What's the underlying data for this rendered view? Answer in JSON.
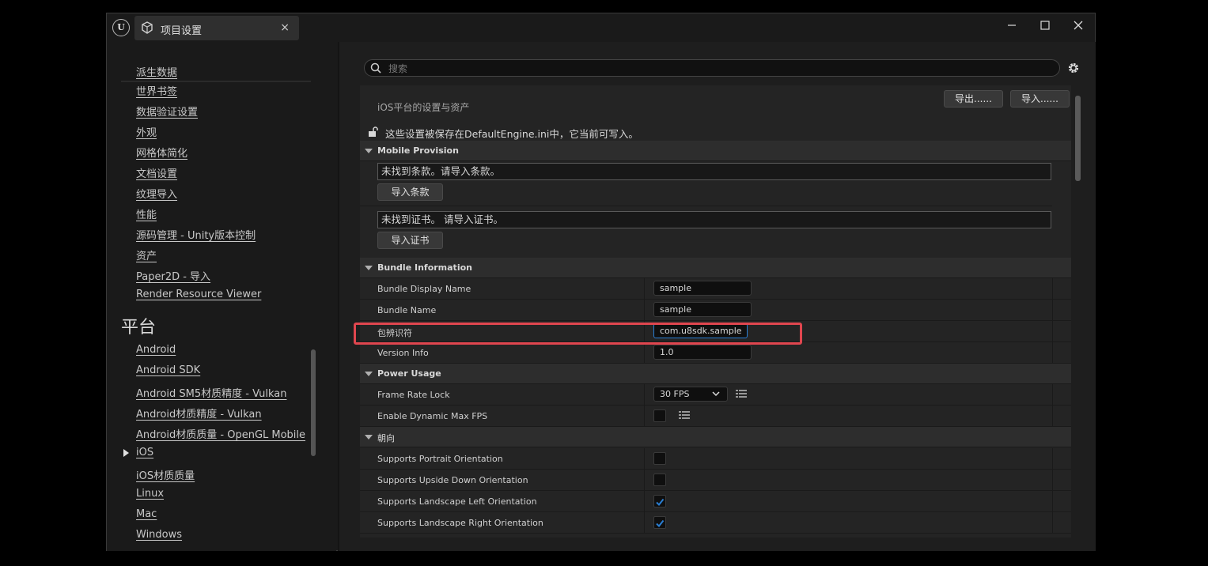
{
  "window": {
    "tab_title": "项目设置",
    "tab_close": "×"
  },
  "sidebar": {
    "items_top": [
      {
        "label": "派生数据"
      },
      {
        "label": "世界书签"
      },
      {
        "label": "数据验证设置"
      },
      {
        "label": "外观"
      },
      {
        "label": "网格体简化"
      },
      {
        "label": "文档设置"
      },
      {
        "label": "纹理导入"
      },
      {
        "label": "性能"
      },
      {
        "label": "源码管理 - Unity版本控制"
      },
      {
        "label": "资产"
      },
      {
        "label": "Paper2D - 导入"
      },
      {
        "label": "Render Resource Viewer"
      }
    ],
    "platform_heading": "平台",
    "items_platform": [
      {
        "label": "Android"
      },
      {
        "label": "Android SDK"
      },
      {
        "label": "Android SM5材质精度 - Vulkan"
      },
      {
        "label": "Android材质精度 - Vulkan"
      },
      {
        "label": "Android材质质量 - OpenGL Mobile"
      },
      {
        "label": "iOS",
        "selected": true
      },
      {
        "label": "iOS材质质量"
      },
      {
        "label": "Linux"
      },
      {
        "label": "Mac"
      },
      {
        "label": "Windows"
      }
    ]
  },
  "search": {
    "placeholder": "搜索",
    "value": ""
  },
  "panel": {
    "header_text": "iOS平台的设置与资产",
    "export_label": "导出......",
    "import_label": "导入......",
    "notice": "这些设置被保存在DefaultEngine.ini中，它当前可写入。"
  },
  "mobile_provision": {
    "title": "Mobile Provision",
    "provision_msg": "未找到条款。请导入条款。",
    "import_provision": "导入条款",
    "cert_msg": "未找到证书。 请导入证书。",
    "import_cert": "导入证书"
  },
  "bundle": {
    "title": "Bundle Information",
    "rows": [
      {
        "name": "Bundle Display Name",
        "value": "sample"
      },
      {
        "name": "Bundle Name",
        "value": "sample"
      },
      {
        "name": "包辨识符",
        "value": "com.u8sdk.sample"
      },
      {
        "name": "Version Info",
        "value": "1.0"
      }
    ]
  },
  "power": {
    "title": "Power Usage",
    "frame_rate_label": "Frame Rate Lock",
    "frame_rate_value": "30 FPS",
    "dynamic_fps_label": "Enable Dynamic Max FPS",
    "dynamic_fps_checked": false
  },
  "orientation": {
    "title": "朝向",
    "rows": [
      {
        "name": "Supports Portrait Orientation",
        "checked": false
      },
      {
        "name": "Supports Upside Down Orientation",
        "checked": false
      },
      {
        "name": "Supports Landscape Left Orientation",
        "checked": true
      },
      {
        "name": "Supports Landscape Right Orientation",
        "checked": true
      }
    ]
  },
  "colors": {
    "accent": "#2a7fd4",
    "highlight": "#e0464f"
  }
}
